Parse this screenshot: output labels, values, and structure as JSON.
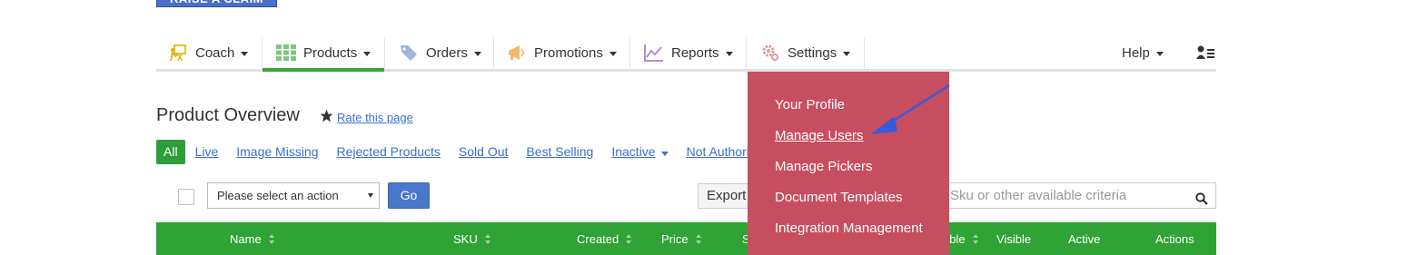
{
  "top_button": {
    "label": "RAISE A CLAIM"
  },
  "nav": {
    "items": [
      {
        "label": "Coach",
        "icon": "coach-icon"
      },
      {
        "label": "Products",
        "icon": "grid-icon"
      },
      {
        "label": "Orders",
        "icon": "tag-icon"
      },
      {
        "label": "Promotions",
        "icon": "megaphone-icon"
      },
      {
        "label": "Reports",
        "icon": "chart-icon"
      },
      {
        "label": "Settings",
        "icon": "gear-icon"
      }
    ],
    "help_label": "Help",
    "user_menu_icon": "user-list-icon",
    "active_item": "Products"
  },
  "page": {
    "title": "Product Overview",
    "rate_label": "Rate this page"
  },
  "filters": {
    "all_label": "All",
    "tabs": [
      "Live",
      "Image Missing",
      "Rejected Products",
      "Sold Out",
      "Best Selling",
      "Inactive",
      "Not Authorized"
    ]
  },
  "toolbar": {
    "action_placeholder": "Please select an action",
    "go_label": "Go",
    "export_label": "Export",
    "search_placeholder": "Sku or other available criteria"
  },
  "table": {
    "headers": [
      "Name",
      "SKU",
      "Created",
      "Price",
      "S",
      "able",
      "Visible",
      "Active",
      "Actions"
    ]
  },
  "settings_menu": {
    "items": [
      "Your Profile",
      "Manage Users",
      "Manage Pickers",
      "Document Templates",
      "Integration Management"
    ],
    "highlighted": "Manage Users"
  },
  "colors": {
    "accent_green": "#2fa336",
    "link_blue": "#3a6fd0",
    "dropdown_bg": "#c74e5e",
    "button_blue": "#4a78c9",
    "annotation_arrow": "#3b5bd6"
  }
}
